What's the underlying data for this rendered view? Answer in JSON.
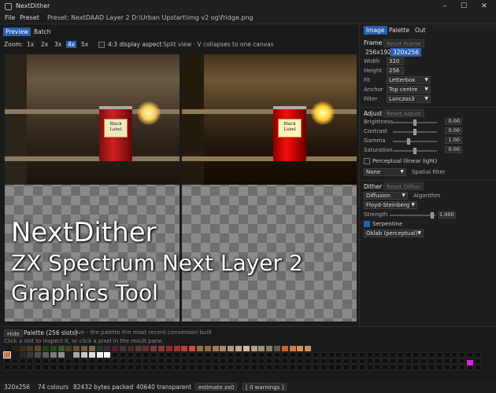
{
  "window": {
    "title": "NextDither",
    "minimize": "–",
    "maximize": "☐",
    "close": "✕"
  },
  "menu": {
    "file": "File",
    "preset": "Preset",
    "preset_path": "Preset: NextDAAD Layer 2  D:\\Urban Upstart\\img v2 og\\fridge.png"
  },
  "view_tabs": {
    "preview": "Preview",
    "batch": "Batch"
  },
  "zoom": {
    "label": "Zoom:",
    "options": [
      "1x",
      "2x",
      "3x",
      "4x",
      "5x"
    ],
    "selected": "4x",
    "aspect_label": "4:3 display aspect",
    "split_label": "Split view · V collapses to one canvas"
  },
  "can_label": "Black Label",
  "overlay": {
    "line1": "NextDither",
    "line2": "ZX Spectrum Next Layer 2",
    "line3": "Graphics Tool"
  },
  "right_tabs": {
    "image": "Image",
    "palette": "Palette",
    "out": "Out"
  },
  "frame": {
    "title": "Frame",
    "reset": "Reset Frame",
    "size_a": "256x192",
    "size_b": "320x256",
    "width_label": "Width",
    "width": "320",
    "height_label": "Height",
    "height": "256",
    "fit_label": "Fit",
    "fit": "Letterbox",
    "anchor_label": "Anchor",
    "anchor": "Top centre",
    "filter_label": "Filter",
    "filter": "Lanczos3"
  },
  "adjust": {
    "title": "Adjust",
    "reset": "Reset Adjust",
    "rows": [
      {
        "label": "Brightness",
        "value": "0.00",
        "level": 0.5
      },
      {
        "label": "Contrast",
        "value": "0.00",
        "level": 0.5
      },
      {
        "label": "Gamma",
        "value": "1.00",
        "level": 0.35
      },
      {
        "label": "Saturation",
        "value": "0.00",
        "level": 0.5
      }
    ],
    "perceptual": "Perceptual (linear light)",
    "spatial": "None",
    "spatial_label": "Spatial filter"
  },
  "dither": {
    "title": "Dither",
    "reset": "Reset Dither",
    "algorithm": "Diffusion",
    "algorithm_label": "Algorithm",
    "kernel": "Floyd-Steinberg",
    "strength_label": "Strength",
    "strength": "1.000",
    "strength_level": 1.0,
    "serpentine": "Serpentine",
    "colorspace": "Oklab (perceptual)"
  },
  "palette_panel": {
    "hide": "Hide",
    "title": "Palette (256 slots)",
    "subtitle": "live - the palette the most recent conversion built",
    "hint": "Click a slot to inspect it, or click a pixel in the result pane."
  },
  "palette_colors": [
    "#201810",
    "#2a2014",
    "#3b2e1e",
    "#4a3a26",
    "#5a482e",
    "#2a3b1a",
    "#1e4a1e",
    "#3a5a20",
    "#4a3e24",
    "#5e4e34",
    "#6e5a3c",
    "#7e6a48",
    "#223a2a",
    "#3a2a44",
    "#502030",
    "#3a3a3a",
    "#4a2a2a",
    "#5a3838",
    "#6a3030",
    "#7a4040",
    "#8a3a3a",
    "#9a2a2a",
    "#aa3030",
    "#b84040",
    "#c05040",
    "#a06a3a",
    "#8a6a4a",
    "#9a7a5a",
    "#aa8a6a",
    "#b89a78",
    "#c8a888",
    "#d8b898",
    "#b8a080",
    "#a09078",
    "#8a7a6a",
    "#6a5a4a",
    "#c86030",
    "#d07a40",
    "#e09050",
    "#c89060"
  ],
  "palette_row2": [
    "#c87a4a",
    "#1a1a1a",
    "#2a2a2a",
    "#3a3a3a",
    "#4e4e4e",
    "#5e5e5e",
    "#7a7a7a",
    "#8e8e8e",
    "#1c1c1c",
    "#a8a8a8",
    "#c8c8c8",
    "#e0e0e0",
    "#f4f4f4",
    "#ffffff"
  ],
  "status": {
    "size": "320x256",
    "colours": "74 colours",
    "bytes": "82432 bytes packed",
    "transparent": "40640 transparent",
    "estimate": "estimate zx0",
    "warnings": "[ 0 warnings ]"
  },
  "colors": {
    "accent": "#2a5fb0",
    "magenta": "#e020e0"
  }
}
